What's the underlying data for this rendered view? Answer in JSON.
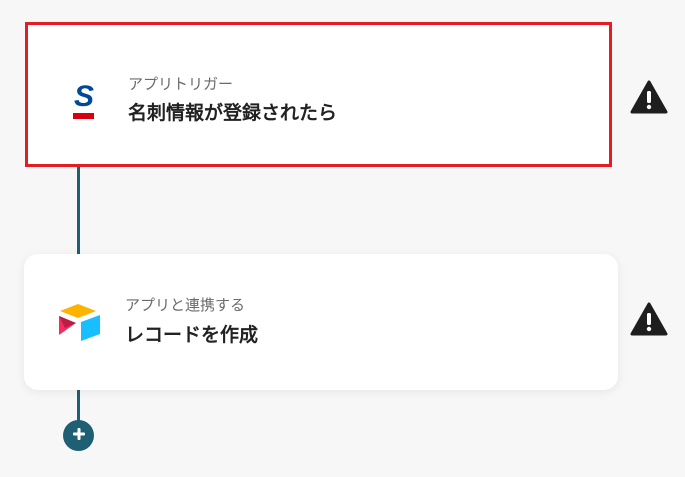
{
  "flow": {
    "steps": [
      {
        "subtitle": "アプリトリガー",
        "title": "名刺情報が登録されたら",
        "app_icon": "sansan-icon",
        "status_icon": "warning-icon",
        "selected": true
      },
      {
        "subtitle": "アプリと連携する",
        "title": "レコードを作成",
        "app_icon": "airtable-icon",
        "status_icon": "warning-icon",
        "selected": false
      }
    ],
    "add_button_icon": "plus-icon"
  },
  "colors": {
    "connector": "#1f5f73",
    "selection_border": "#e21d24",
    "warning": "#1e1e1e",
    "sansan_blue": "#004898",
    "sansan_red": "#d7000f"
  }
}
